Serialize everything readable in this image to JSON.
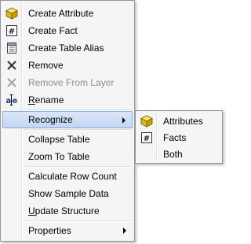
{
  "menu": {
    "items": [
      {
        "label": "Create Attribute",
        "icon": "attribute-cube-icon"
      },
      {
        "label": "Create Fact",
        "icon": "fact-icon"
      },
      {
        "label": "Create Table Alias",
        "icon": "table-alias-icon"
      },
      {
        "label": "Remove",
        "icon": "remove-x-icon"
      },
      {
        "label": "Remove From Layer",
        "icon": "remove-from-layer-icon",
        "disabled": true
      },
      {
        "label": "Rename",
        "icon": "rename-icon",
        "underline": "R"
      },
      {
        "label": "Recognize",
        "highlighted": true,
        "submenu": true
      },
      {
        "label": "Collapse Table"
      },
      {
        "label": "Zoom To Table"
      },
      {
        "label": "Calculate Row Count"
      },
      {
        "label": "Show Sample Data"
      },
      {
        "label": "Update Structure",
        "underline": "U"
      },
      {
        "label": "Properties",
        "submenu": true
      }
    ],
    "rename_rest": "ename",
    "update_rest": "pdate Structure"
  },
  "submenu": {
    "items": [
      {
        "label": "Attributes",
        "icon": "attribute-cube-icon"
      },
      {
        "label": "Facts",
        "icon": "fact-icon"
      },
      {
        "label": "Both"
      }
    ]
  },
  "colors": {
    "menu_bg": "#f5f5f5",
    "highlight_top": "#dae6f8",
    "highlight_bottom": "#c4d6f3",
    "highlight_border": "#8aa9d8",
    "disabled_text": "#8d8d8d",
    "cube_yellow": "#f2d21b"
  }
}
